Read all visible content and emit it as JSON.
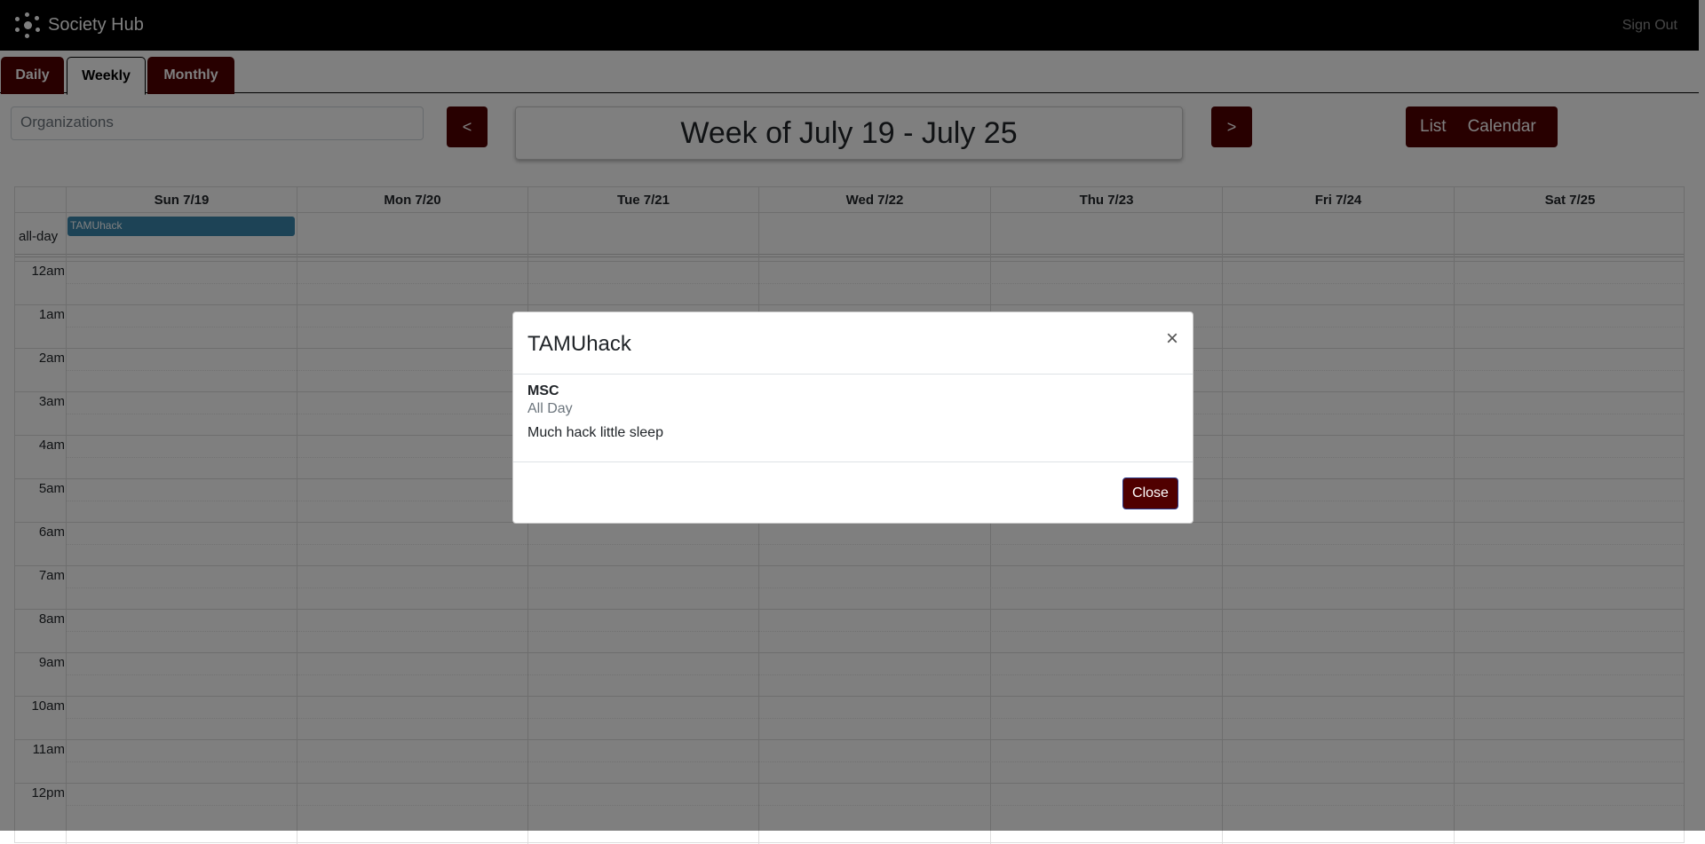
{
  "navbar": {
    "brand": "Society Hub",
    "signout": "Sign Out",
    "logo_icon": "molecule-icon"
  },
  "tabs": [
    {
      "label": "Daily"
    },
    {
      "label": "Weekly"
    },
    {
      "label": "Monthly"
    }
  ],
  "toolbar": {
    "org_placeholder": "Organizations",
    "prev_label": "<",
    "next_label": ">",
    "week_title": "Week of July 19 - July 25",
    "view_list": "List",
    "view_calendar": "Calendar"
  },
  "calendar": {
    "days": [
      "Sun 7/19",
      "Mon 7/20",
      "Tue 7/21",
      "Wed 7/22",
      "Thu 7/23",
      "Fri 7/24",
      "Sat 7/25"
    ],
    "allday_label": "all-day",
    "event_label": "TAMUhack",
    "hours": [
      "12am",
      "1am",
      "2am",
      "3am",
      "4am",
      "5am",
      "6am",
      "7am",
      "8am",
      "9am",
      "10am",
      "11am",
      "12pm"
    ]
  },
  "modal": {
    "title": "TAMUhack",
    "close_icon": "close-icon",
    "organization": "MSC",
    "time": "All Day",
    "description": "Much hack little sleep",
    "close_label": "Close"
  },
  "colors": {
    "brand": "#500000",
    "navbar": "#000000",
    "event": "#3a87ad"
  }
}
